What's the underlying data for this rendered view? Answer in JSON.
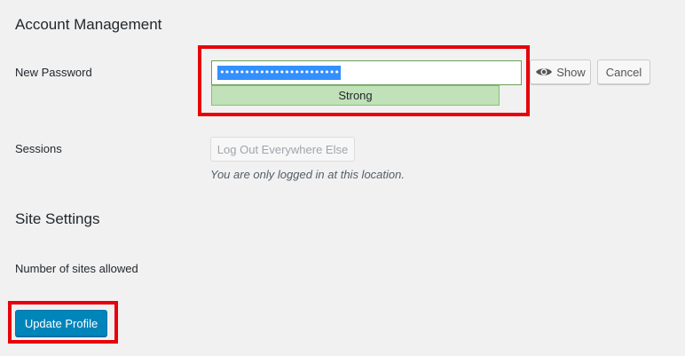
{
  "account_section": {
    "title": "Account Management"
  },
  "password": {
    "label": "New Password",
    "masked_value": "••••••••••••••••••••••••",
    "strength_text": "Strong",
    "show_label": "Show",
    "cancel_label": "Cancel"
  },
  "sessions": {
    "label": "Sessions",
    "button_label": "Log Out Everywhere Else",
    "hint": "You are only logged in at this location."
  },
  "site_section": {
    "title": "Site Settings",
    "sites_allowed_label": "Number of sites allowed"
  },
  "footer": {
    "update_label": "Update Profile"
  },
  "colors": {
    "annotation": "#e8000b",
    "primary": "#0085ba",
    "strength_bg": "#c1e1b9",
    "selection": "#3390ff"
  },
  "icons": {
    "show": "eye-icon"
  }
}
